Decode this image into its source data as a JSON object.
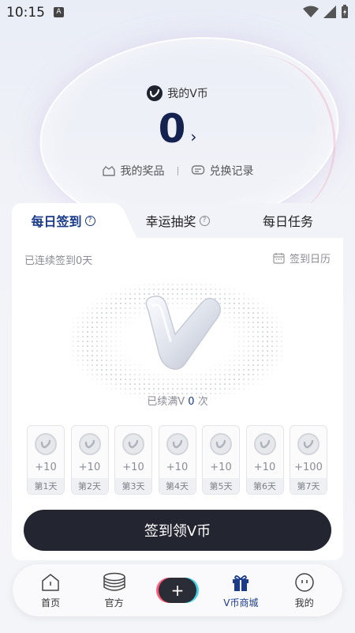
{
  "status": {
    "time": "10:15",
    "indicator": "A"
  },
  "coins": {
    "title": "我的V币",
    "value": "0",
    "arrow": "›",
    "prizes_label": "我的奖品",
    "records_label": "兑换记录"
  },
  "tabs": [
    {
      "label": "每日签到",
      "help": "?"
    },
    {
      "label": "幸运抽奖",
      "help": "?"
    },
    {
      "label": "每日任务"
    }
  ],
  "signin": {
    "streak_text": "已连续签到0天",
    "calendar_label": "签到日历",
    "continued_prefix": "已续满V",
    "continued_count": "0",
    "continued_suffix": "次",
    "days": [
      {
        "points": "+10",
        "label": "第1天"
      },
      {
        "points": "+10",
        "label": "第2天"
      },
      {
        "points": "+10",
        "label": "第3天"
      },
      {
        "points": "+10",
        "label": "第4天"
      },
      {
        "points": "+10",
        "label": "第5天"
      },
      {
        "points": "+10",
        "label": "第6天"
      },
      {
        "points": "+100",
        "label": "第7天"
      }
    ],
    "button_label": "签到领V币"
  },
  "nav": [
    {
      "label": "首页",
      "icon": "house-icon"
    },
    {
      "label": "官方",
      "icon": "coin-stack-icon"
    },
    {
      "label": "+",
      "icon": "plus-icon"
    },
    {
      "label": "V币商城",
      "icon": "gift-icon"
    },
    {
      "label": "我的",
      "icon": "face-icon"
    }
  ],
  "colors": {
    "accent": "#1a3a8a",
    "button": "#232631"
  }
}
